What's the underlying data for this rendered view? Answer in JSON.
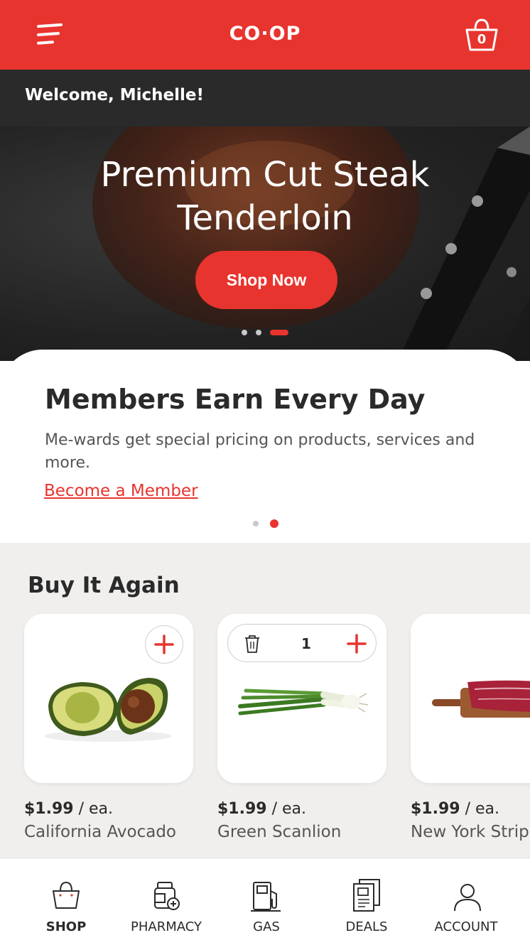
{
  "header": {
    "logo": "CO·OP",
    "cart_count": "0"
  },
  "welcome": "Welcome, Michelle!",
  "hero": {
    "title_line1": "Premium Cut Steak",
    "title_line2": "Tenderloin",
    "cta": "Shop Now"
  },
  "members": {
    "title": "Members Earn Every Day",
    "description": "Me-wards get special pricing on products, services and more.",
    "link": "Become a Member"
  },
  "buy_again": {
    "title": "Buy It Again",
    "products": [
      {
        "price": "$1.99",
        "unit": " / ea.",
        "name": "California Avocado"
      },
      {
        "price": "$1.99",
        "unit": " / ea.",
        "name": "Green Scanlion",
        "quantity": "1"
      },
      {
        "price": "$1.99",
        "unit": " / ea.",
        "name": "New York Strip"
      }
    ]
  },
  "nav": {
    "items": [
      {
        "label": "SHOP"
      },
      {
        "label": "PHARMACY"
      },
      {
        "label": "GAS"
      },
      {
        "label": "DEALS"
      },
      {
        "label": "ACCOUNT"
      }
    ]
  },
  "colors": {
    "brand_red": "#e8342e",
    "dark_bar": "#2a2a2a",
    "section_bg": "#f1efed"
  }
}
